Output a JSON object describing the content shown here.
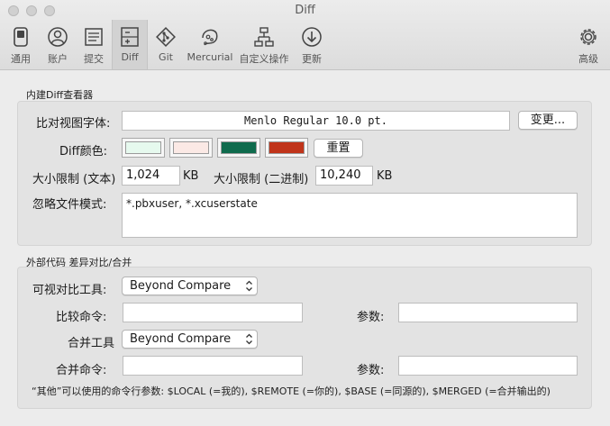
{
  "window": {
    "title": "Diff"
  },
  "toolbar": {
    "items": [
      {
        "label": "通用",
        "icon": "general-icon"
      },
      {
        "label": "账户",
        "icon": "account-icon"
      },
      {
        "label": "提交",
        "icon": "commit-icon"
      },
      {
        "label": "Diff",
        "icon": "diff-icon",
        "active": true
      },
      {
        "label": "Git",
        "icon": "git-icon"
      },
      {
        "label": "Mercurial",
        "icon": "mercurial-icon"
      },
      {
        "label": "自定义操作",
        "icon": "custom-actions-icon"
      },
      {
        "label": "更新",
        "icon": "update-icon"
      },
      {
        "label": "高级",
        "icon": "advanced-gear-icon"
      }
    ]
  },
  "builtin": {
    "section_title": "内建Diff查看器",
    "font_label": "比对视图字体:",
    "font_value": "Menlo Regular 10.0 pt.",
    "change_button": "变更...",
    "colors_label": "Diff颜色:",
    "colors": [
      "#e6f9ee",
      "#fbe9e5",
      "#0f6b4d",
      "#c0341a"
    ],
    "reset_button": "重置",
    "size_text_label": "大小限制 (文本)",
    "size_text_value": "1,024",
    "size_text_unit": "KB",
    "size_binary_label": "大小限制 (二进制)",
    "size_binary_value": "10,240",
    "size_binary_unit": "KB",
    "ignore_label": "忽略文件模式:",
    "ignore_value": "*.pbxuser, *.xcuserstate"
  },
  "external": {
    "section_title": "外部代码 差异对比/合并",
    "visual_diff_label": "可视对比工具:",
    "visual_diff_value": "Beyond Compare",
    "diff_cmd_label": "比较命令:",
    "diff_cmd_value": "",
    "diff_args_label": "参数:",
    "diff_args_value": "",
    "merge_tool_label": "合并工具",
    "merge_tool_value": "Beyond Compare",
    "merge_cmd_label": "合并命令:",
    "merge_cmd_value": "",
    "merge_args_label": "参数:",
    "merge_args_value": "",
    "hint": "“其他”可以使用的命令行参数: $LOCAL (=我的), $REMOTE (=你的), $BASE (=同源的), $MERGED (=合并输出的)"
  }
}
